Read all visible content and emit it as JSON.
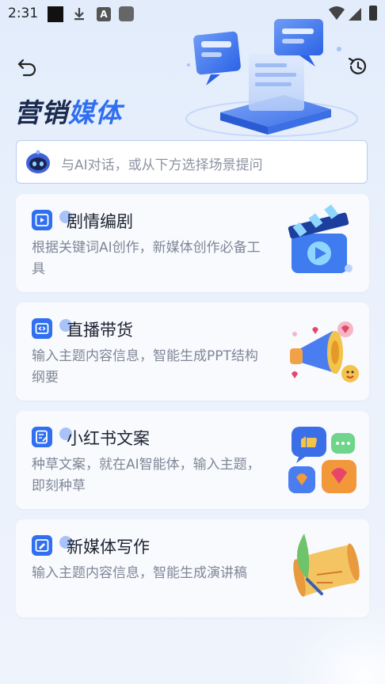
{
  "status_bar": {
    "time": "2:31",
    "notification_icons": [
      "black-square-icon",
      "download-icon",
      "a-icon",
      "square-icon"
    ],
    "system_icons": [
      "wifi-icon",
      "signal-icon",
      "battery-icon"
    ]
  },
  "header": {
    "title_part1": "营销",
    "title_part2": "媒体",
    "back_icon": "back-icon",
    "history_icon": "history-icon"
  },
  "search": {
    "placeholder": "与AI对话，或从下方选择场景提问"
  },
  "cards": [
    {
      "title": "剧情编剧",
      "desc": "根据关键词AI创作，新媒体创作必备工具",
      "icon": "video-icon",
      "art": "clapperboard-illustration"
    },
    {
      "title": "直播带货",
      "desc": "输入主题内容信息，智能生成PPT结构纲要",
      "icon": "live-stream-icon",
      "art": "megaphone-illustration"
    },
    {
      "title": "小红书文案",
      "desc": "种草文案，就在AI智能体，输入主题，即刻种草",
      "icon": "note-edit-icon",
      "art": "chat-bubbles-illustration"
    },
    {
      "title": "新媒体写作",
      "desc": "输入主题内容信息，智能生成演讲稿",
      "icon": "pen-icon",
      "art": "scroll-quill-illustration"
    }
  ],
  "colors": {
    "accent": "#2f6ff0",
    "title_dark": "#1b2a4e",
    "desc_gray": "#7f8696"
  }
}
